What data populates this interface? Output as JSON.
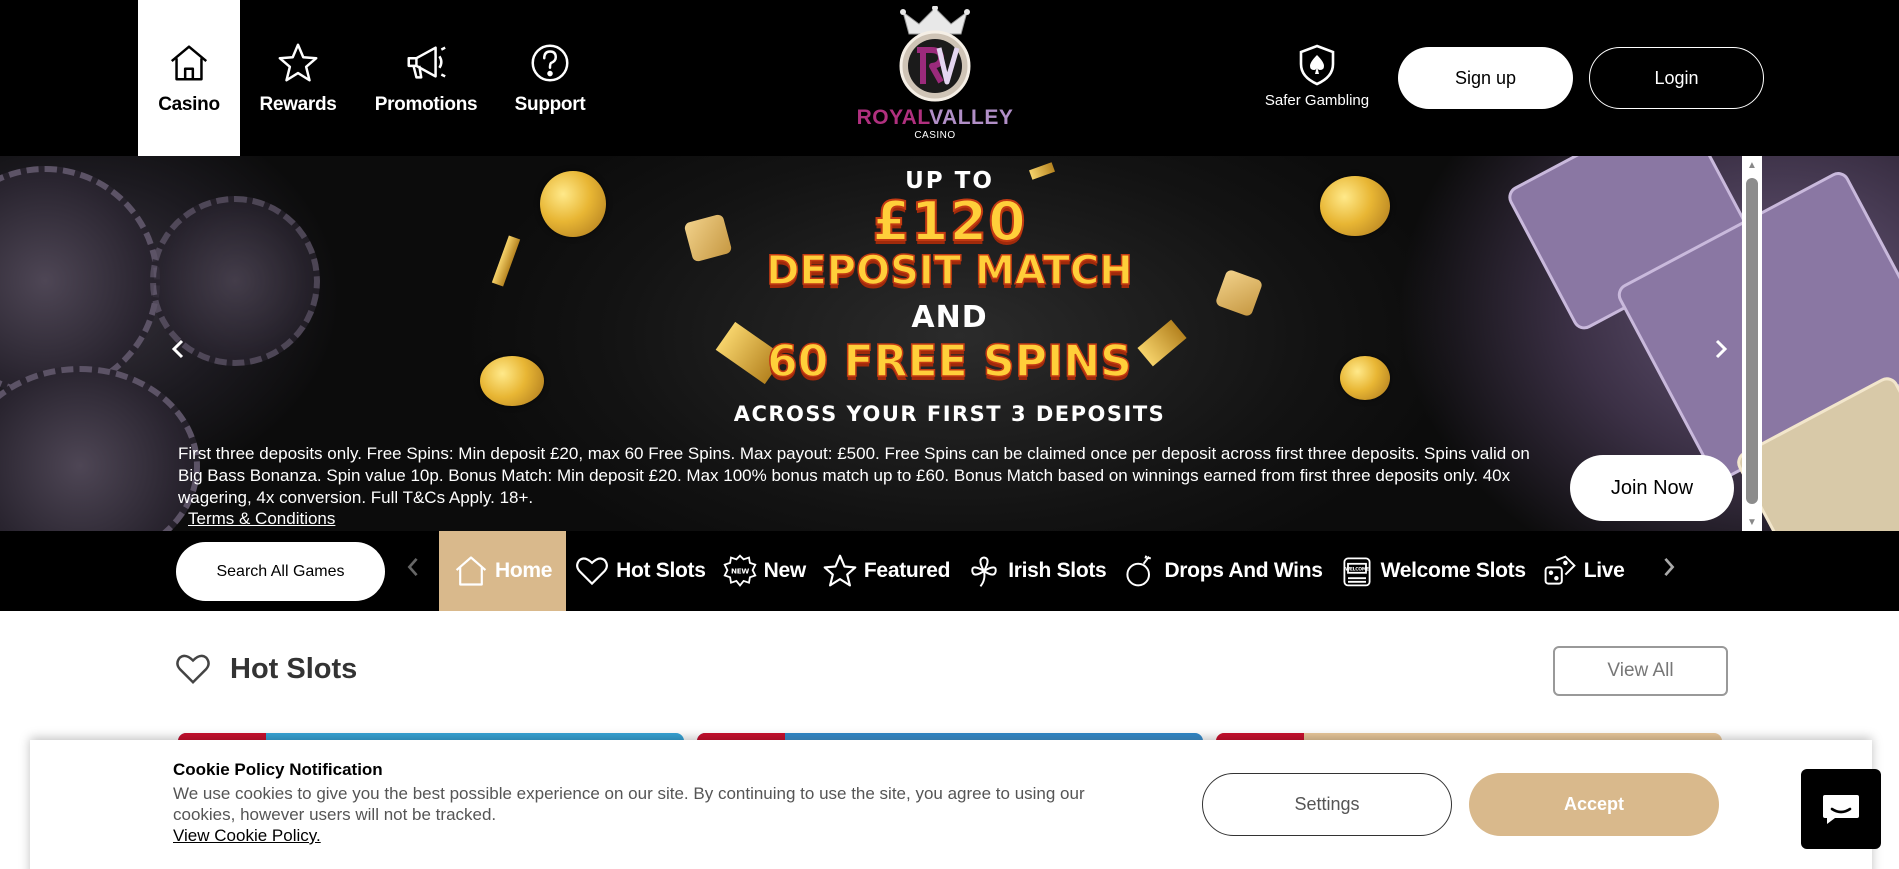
{
  "header": {
    "nav": [
      {
        "label": "Casino",
        "icon": "home-icon",
        "active": true
      },
      {
        "label": "Rewards",
        "icon": "star-icon",
        "active": false
      },
      {
        "label": "Promotions",
        "icon": "megaphone-icon",
        "active": false
      },
      {
        "label": "Support",
        "icon": "question-icon",
        "active": false
      }
    ],
    "logo": {
      "brand_part1": "ROYAL",
      "brand_part2": "VALLEY",
      "sub": "CASINO"
    },
    "safer_gambling": "Safer Gambling",
    "signup_label": "Sign up",
    "login_label": "Login"
  },
  "hero": {
    "promo": {
      "up_to": "UP TO",
      "amount": "£120",
      "deposit_match": "DEPOSIT MATCH",
      "and": "AND",
      "free_spins": "60 FREE SPINS",
      "across": "ACROSS YOUR FIRST 3 DEPOSITS"
    },
    "terms_text": "First three deposits only. Free Spins: Min deposit £20, max 60 Free Spins. Max payout: £500. Free Spins can be claimed once per deposit across first three deposits. Spins valid on Big Bass Bonanza. Spin value 10p. Bonus Match: Min deposit £20. Max 100% bonus match up to £60. Bonus Match based on winnings earned from first three deposits only. 40x wagering, 4x conversion. Full T&Cs Apply. 18+.",
    "terms_link": "Terms & Conditions",
    "join_label": "Join Now",
    "prev_glyph": "‹",
    "next_glyph": "›"
  },
  "categories": {
    "search_label": "Search All Games",
    "items": [
      {
        "label": "Home",
        "icon": "home-icon",
        "active": true
      },
      {
        "label": "Hot Slots",
        "icon": "heart-icon"
      },
      {
        "label": "New",
        "icon": "new-badge-icon"
      },
      {
        "label": "Featured",
        "icon": "star-icon"
      },
      {
        "label": "Irish Slots",
        "icon": "clover-icon"
      },
      {
        "label": "Drops And Wins",
        "icon": "bomb-icon"
      },
      {
        "label": "Welcome Slots",
        "icon": "slot-machine-icon"
      },
      {
        "label": "Live",
        "icon": "dice-icon"
      }
    ]
  },
  "main": {
    "section_title": "Hot Slots",
    "view_all_label": "View All"
  },
  "cookie": {
    "title": "Cookie Policy Notification",
    "message": "We use cookies to give you the best possible experience on our site. By continuing to use the site, you agree to using our cookies, however users will not be tracked.",
    "link": "View Cookie Policy.",
    "settings_label": "Settings",
    "accept_label": "Accept"
  },
  "colors": {
    "accent": "#d9b98c",
    "header_bg": "#000000",
    "brand_pink": "#b0307f",
    "promo_gold": "#ffcf3a"
  }
}
